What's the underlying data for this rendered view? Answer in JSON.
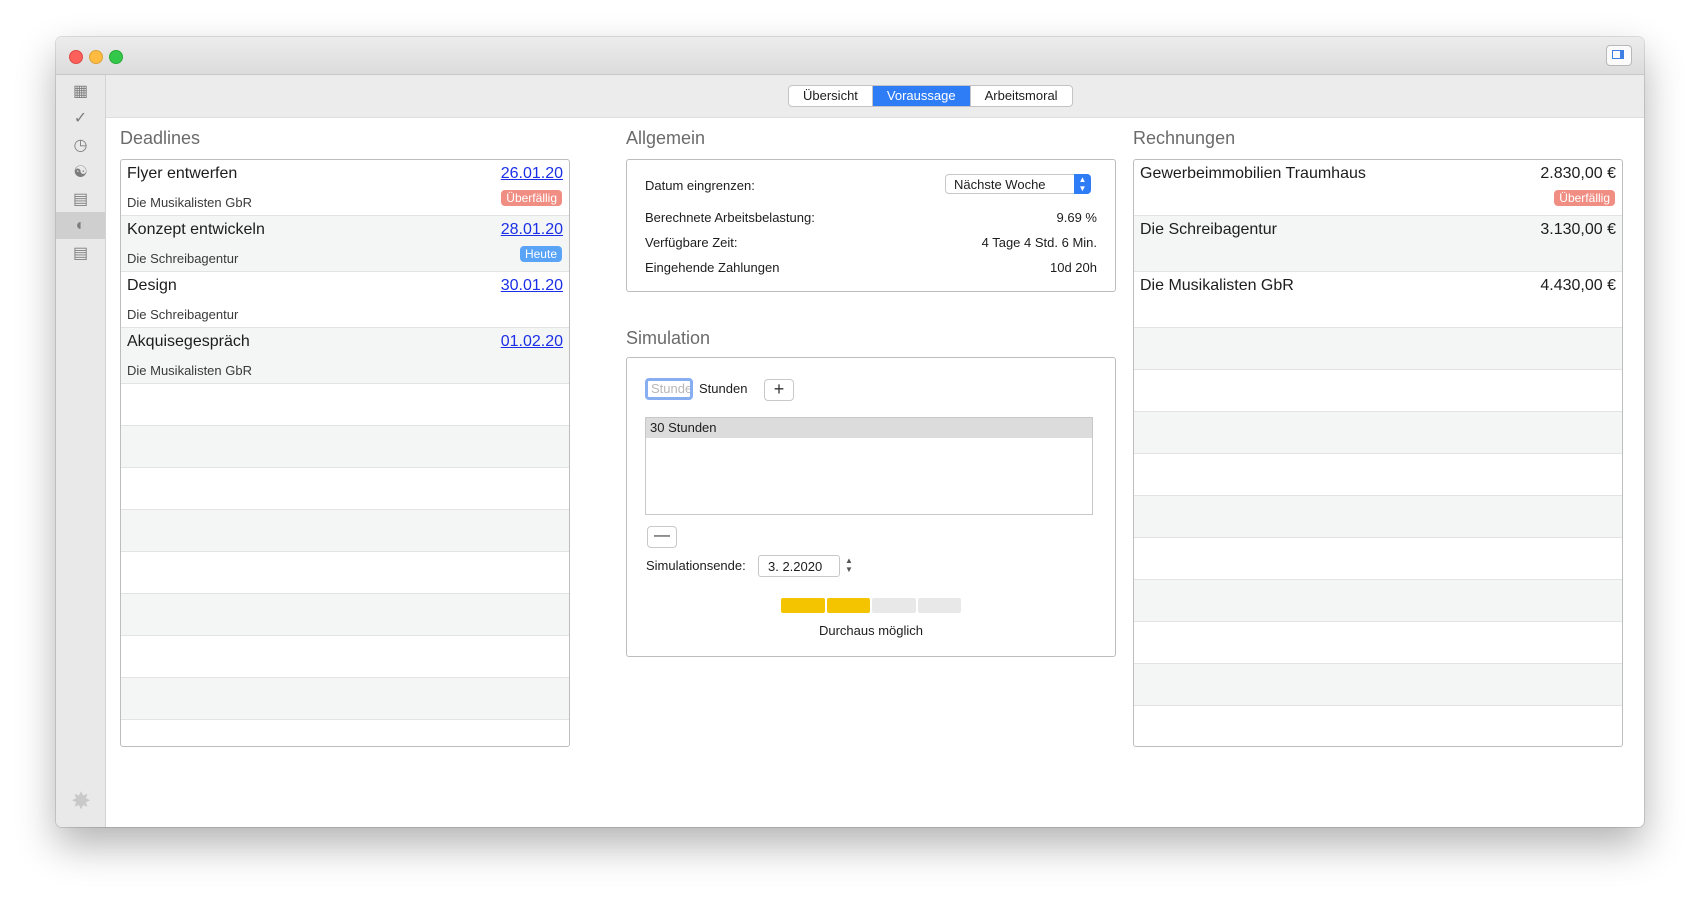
{
  "tabs": [
    {
      "label": "Übersicht",
      "selected": false
    },
    {
      "label": "Voraussage",
      "selected": true
    },
    {
      "label": "Arbeitsmoral",
      "selected": false
    }
  ],
  "sidebar": {
    "items": [
      {
        "icon": "layout-icon"
      },
      {
        "icon": "checkmark-icon"
      },
      {
        "icon": "clock-icon"
      },
      {
        "icon": "people-icon"
      },
      {
        "icon": "money-icon"
      },
      {
        "icon": "forecast-icon",
        "active": true
      },
      {
        "icon": "invoice-icon"
      }
    ]
  },
  "deadlines": {
    "title": "Deadlines",
    "items": [
      {
        "title": "Flyer entwerfen",
        "client": "Die Musikalisten GbR",
        "date": "26.01.20",
        "badge": "Überfällig",
        "badge_type": "over"
      },
      {
        "title": "Konzept entwickeln",
        "client": "Die Schreibagentur",
        "date": "28.01.20",
        "badge": "Heute",
        "badge_type": "today"
      },
      {
        "title": "Design",
        "client": "Die Schreibagentur",
        "date": "30.01.20"
      },
      {
        "title": "Akquisegespräch",
        "client": "Die Musikalisten GbR",
        "date": "01.02.20"
      }
    ]
  },
  "general": {
    "title": "Allgemein",
    "date_label": "Datum eingrenzen:",
    "date_select": "Nächste Woche",
    "rows": [
      {
        "label": "Berechnete Arbeitsbelastung:",
        "value": "9.69 %"
      },
      {
        "label": "Verfügbare Zeit:",
        "value": "4 Tage 4 Std. 6 Min."
      },
      {
        "label": "Eingehende Zahlungen",
        "value": "10d 20h"
      }
    ]
  },
  "simulation": {
    "title": "Simulation",
    "input_placeholder": "Stunden",
    "unit_label": "Stunden",
    "plus": "+",
    "minus": "—",
    "list": [
      "30 Stunden"
    ],
    "end_label": "Simulationsende:",
    "end_date": "3.  2.2020",
    "feasibility": "Durchaus möglich",
    "level_filled": 2,
    "level_total": 4,
    "fill_color": "#f5c400",
    "empty_color": "#e8e8e8"
  },
  "invoices": {
    "title": "Rechnungen",
    "items": [
      {
        "client": "Gewerbeimmobilien Traumhaus",
        "amount": "2.830,00 €",
        "badge": "Überfällig"
      },
      {
        "client": "Die Schreibagentur",
        "amount": "3.130,00 €"
      },
      {
        "client": "Die Musikalisten GbR",
        "amount": "4.430,00 €"
      }
    ]
  }
}
